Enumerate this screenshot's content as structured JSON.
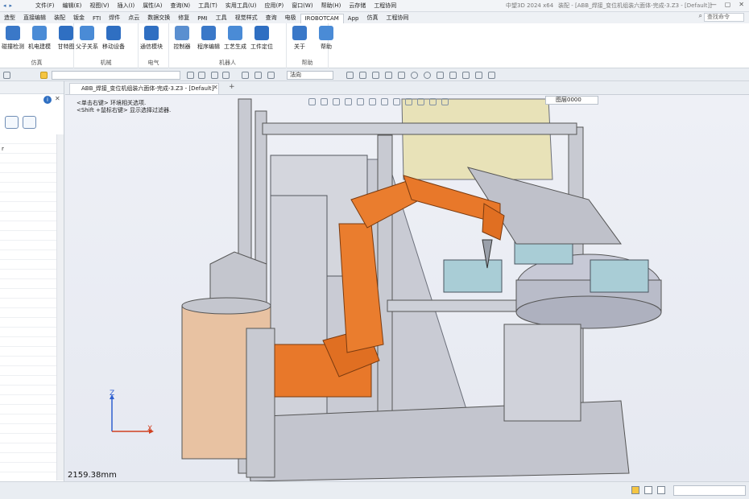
{
  "app": {
    "name": "中望3D 2024 x64",
    "document_title": "装配 - [ABB_焊接_变位机组装六面体-完成-3.Z3 - [Default]]"
  },
  "menu": [
    "文件(F)",
    "编辑(E)",
    "视图(V)",
    "插入(I)",
    "属性(A)",
    "查询(N)",
    "工具(T)",
    "实用工具(U)",
    "应用(P)",
    "窗口(W)",
    "帮助(H)",
    "云存储",
    "工程协同"
  ],
  "ribbon_tabs": [
    "造型",
    "直接编辑",
    "装配",
    "钣金",
    "FTI",
    "焊件",
    "点云",
    "数据交换",
    "修复",
    "PMI",
    "工具",
    "视觉样式",
    "查询",
    "电极",
    "IROBOTCAM",
    "App",
    "仿真",
    "工程协同"
  ],
  "active_tab": "IROBOTCAM",
  "search_placeholder": "查找命令",
  "ribbon_groups": [
    {
      "label": "仿真",
      "buttons": [
        "碰撞检测",
        "机电建模",
        "甘特图"
      ]
    },
    {
      "label": "机械",
      "buttons": [
        "父子关系",
        "移动设备"
      ]
    },
    {
      "label": "电气",
      "buttons": [
        "通信模块"
      ]
    },
    {
      "label": "机器人",
      "buttons": [
        "控制器",
        "程序编辑",
        "工艺生成",
        "工件定位"
      ]
    },
    {
      "label": "帮助",
      "buttons": [
        "关于",
        "帮助"
      ]
    }
  ],
  "toolbar": {
    "filter_value": "法向"
  },
  "doc_tab": "ABB_焊接_变位机组装六面体-完成-3.Z3 - [Default]",
  "viewport": {
    "hint_line1": "<单击右键> 环境相关选项.",
    "hint_line2": "<Shift +鼠标右键> 显示选择过滤器.",
    "scale_readout": "2159.38mm",
    "layer": "图层0000",
    "axis_x": "X",
    "axis_z": "Z"
  },
  "left_panel": {
    "list_first": "r"
  },
  "colors": {
    "robot": "#e8782a",
    "frame": "#c9cbd4",
    "accent": "#2f6fc2"
  }
}
